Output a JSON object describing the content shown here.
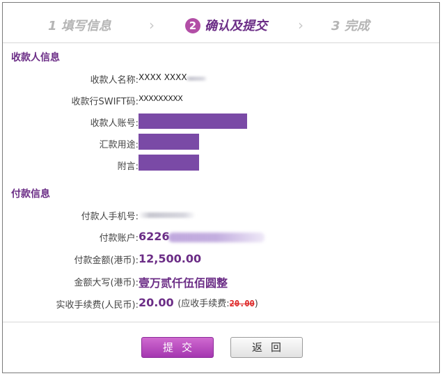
{
  "steps": [
    {
      "num": "1",
      "label": "填写信息"
    },
    {
      "num": "2",
      "label": "确认及提交"
    },
    {
      "num": "3",
      "label": "完成"
    }
  ],
  "step_separator": "›",
  "payee_section": {
    "title": "收款人信息",
    "name_label": "收款人名称:",
    "name_value": "XXXX XXXX",
    "swift_label": "收款行SWIFT码:",
    "swift_value": "XXXXXXXXX",
    "account_label": "收款人账号:",
    "purpose_label": "汇款用途:",
    "remark_label": "附言:"
  },
  "payer_section": {
    "title": "付款信息",
    "phone_label": "付款人手机号:",
    "account_label": "付款账户:",
    "account_prefix": "6226",
    "amount_label": "付款金额(港币):",
    "amount_value": "12,500.00",
    "amount_words_label": "金额大写(港币):",
    "amount_words_value": "壹万贰仟伍佰圆整",
    "fee_label": "实收手续费(人民币):",
    "fee_value": "20.00",
    "fee_note_prefix": "(应收手续费:",
    "fee_original": "20.00",
    "fee_note_suffix": ")"
  },
  "buttons": {
    "submit": "提交",
    "back": "返回"
  },
  "colors": {
    "accent": "#6b2d86",
    "masked_bar": "#7a4aa6",
    "submit_button": "#b24ea6"
  }
}
